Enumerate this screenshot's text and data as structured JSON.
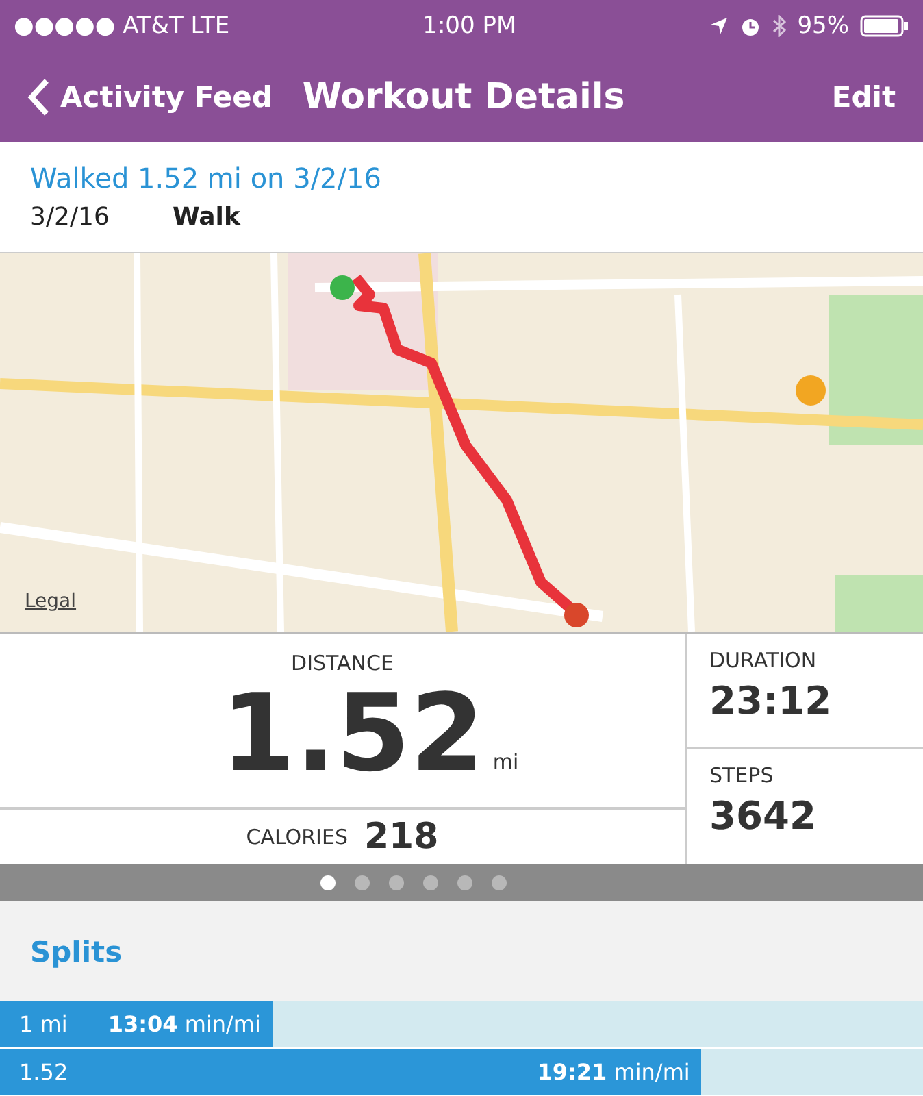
{
  "status_bar": {
    "carrier": "●●●●● AT&T  LTE",
    "time": "1:00 PM",
    "battery": "95%"
  },
  "nav": {
    "back": "Activity Feed",
    "title": "Workout Details",
    "action": "Edit"
  },
  "summary": {
    "headline": "Walked 1.52 mi on 3/2/16",
    "date": "3/2/16",
    "type": "Walk"
  },
  "map": {
    "kind": "picture",
    "legal": "Legal"
  },
  "stats": {
    "distance_label": "DISTANCE",
    "distance": "1.52",
    "distance_unit": "mi",
    "calories_label": "CALORIES",
    "calories": "218",
    "duration_label": "DURATION",
    "duration": "23:12",
    "steps_label": "STEPS",
    "steps": "3642"
  },
  "pages": [
    {
      "selected": true
    },
    {
      "selected": false
    },
    {
      "selected": false
    },
    {
      "selected": false
    },
    {
      "selected": false
    },
    {
      "selected": false
    }
  ],
  "splits": {
    "title": "Splits",
    "rows": [
      {
        "label": "1 mi",
        "pace": "**13:04** min/mi",
        "level": 0.295
      },
      {
        "label": "1.52",
        "pace": "**19:21** min/mi",
        "level": 0.76
      }
    ]
  }
}
